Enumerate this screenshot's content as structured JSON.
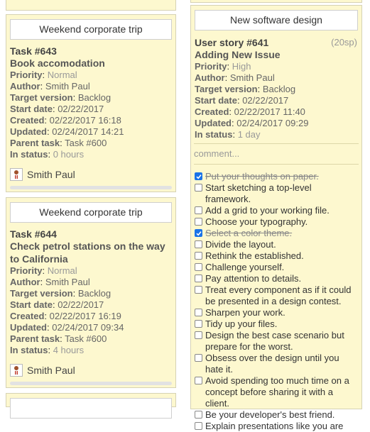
{
  "left_column": {
    "cards": [
      {
        "button": "Weekend corporate trip",
        "task": "Task #643",
        "title": "Book accomodation",
        "priority_label": "Priority",
        "priority": "Normal",
        "author_label": "Author",
        "author": "Smith Paul",
        "target_label": "Target version",
        "target": "Backlog",
        "start_label": "Start date",
        "start": "02/22/2017",
        "created_label": "Created",
        "created": "02/22/2017 16:18",
        "updated_label": "Updated",
        "updated": "02/24/2017 14:21",
        "parent_label": "Parent task",
        "parent": "Task #600",
        "status_label": "In status",
        "status": "0 hours",
        "assignee": "Smith Paul",
        "progress": 0
      },
      {
        "button": "Weekend corporate trip",
        "task": "Task #644",
        "title": "Check petrol stations on the way to California",
        "priority_label": "Priority",
        "priority": "Normal",
        "author_label": "Author",
        "author": "Smith Paul",
        "target_label": "Target version",
        "target": "Backlog",
        "start_label": "Start date",
        "start": "02/22/2017",
        "created_label": "Created",
        "created": "02/22/2017 16:19",
        "updated_label": "Updated",
        "updated": "02/24/2017 09:34",
        "parent_label": "Parent task",
        "parent": "Task #600",
        "status_label": "In status",
        "status": "4 hours",
        "assignee": "Smith Paul",
        "progress": 0
      }
    ]
  },
  "right_column": {
    "card": {
      "button": "New software design",
      "task": "User story #641",
      "story_points": "(20sp)",
      "title": "Adding New Issue",
      "priority_label": "Priority",
      "priority": "High",
      "author_label": "Author",
      "author": "Smith Paul",
      "target_label": "Target version",
      "target": "Backlog",
      "start_label": "Start date",
      "start": "02/22/2017",
      "created_label": "Created",
      "created": "02/22/2017 11:40",
      "updated_label": "Updated",
      "updated": "02/24/2017 09:29",
      "status_label": "In status",
      "status": "1 day",
      "comment_placeholder": "comment...",
      "checklist": [
        {
          "text": "Put your thoughts on paper.",
          "done": true
        },
        {
          "text": "Start sketching a top-level framework.",
          "done": false
        },
        {
          "text": "Add a grid to your working file.",
          "done": false
        },
        {
          "text": "Choose your typography.",
          "done": false
        },
        {
          "text": "Select a color theme.",
          "done": true
        },
        {
          "text": "Divide the layout.",
          "done": false
        },
        {
          "text": "Rethink the established.",
          "done": false
        },
        {
          "text": "Challenge yourself.",
          "done": false
        },
        {
          "text": "Pay attention to details.",
          "done": false
        },
        {
          "text": "Treat every component as if it could be presented in a design contest.",
          "done": false
        },
        {
          "text": "Sharpen your work.",
          "done": false
        },
        {
          "text": "Tidy up your files.",
          "done": false
        },
        {
          "text": "Design the best case scenario but prepare for the worst.",
          "done": false
        },
        {
          "text": "Obsess over the design until you hate it.",
          "done": false
        },
        {
          "text": "Avoid spending too much time on a concept before sharing it with a client.",
          "done": false
        },
        {
          "text": "Be your developer's best friend.",
          "done": false
        },
        {
          "text": "Explain presentations like you are",
          "done": false
        }
      ]
    }
  },
  "colors": {
    "card_bg": "#fdf8cf",
    "checkbox_checked": "#1a73e8"
  },
  "icons": {
    "avatar": "user-avatar-icon",
    "check": "checkmark-icon"
  }
}
